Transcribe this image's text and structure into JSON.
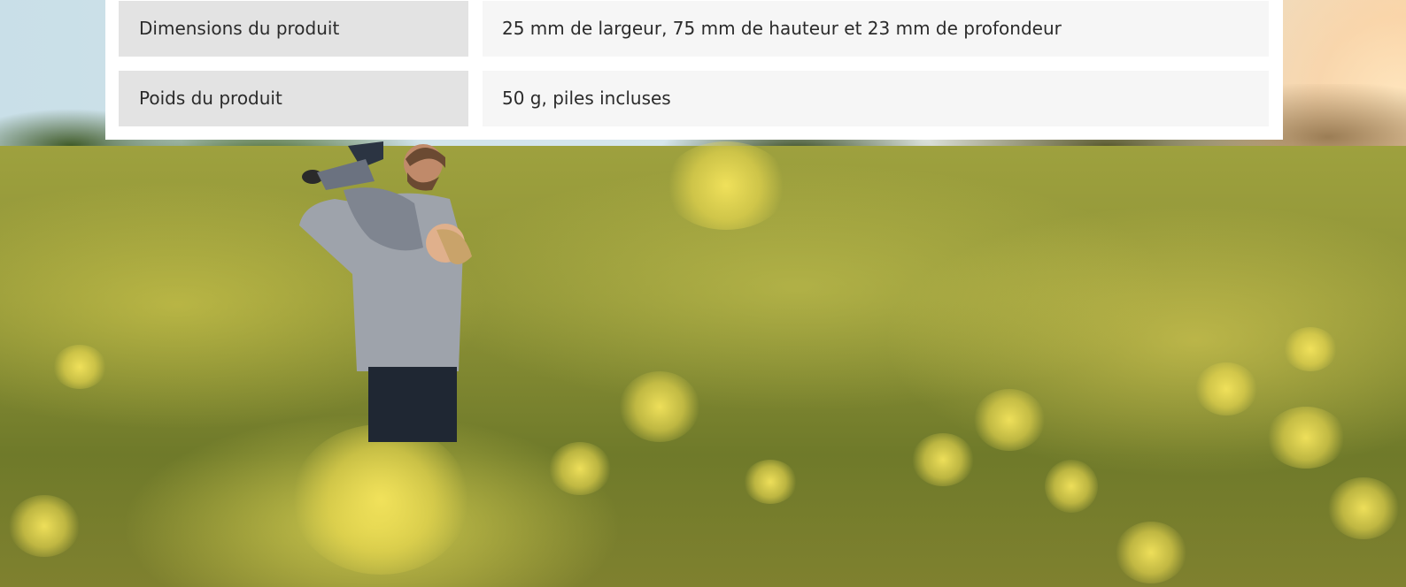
{
  "specs": {
    "rows": [
      {
        "label": "Dimensions du produit",
        "value": "25 mm de largeur, 75 mm de hauteur et 23 mm de profondeur"
      },
      {
        "label": "Poids du produit",
        "value": "50 g, piles incluses"
      }
    ]
  },
  "colors": {
    "label_cell_bg": "#e3e3e3",
    "value_cell_bg": "#f6f6f6",
    "card_bg": "#ffffff",
    "text": "#2b2b2b"
  }
}
